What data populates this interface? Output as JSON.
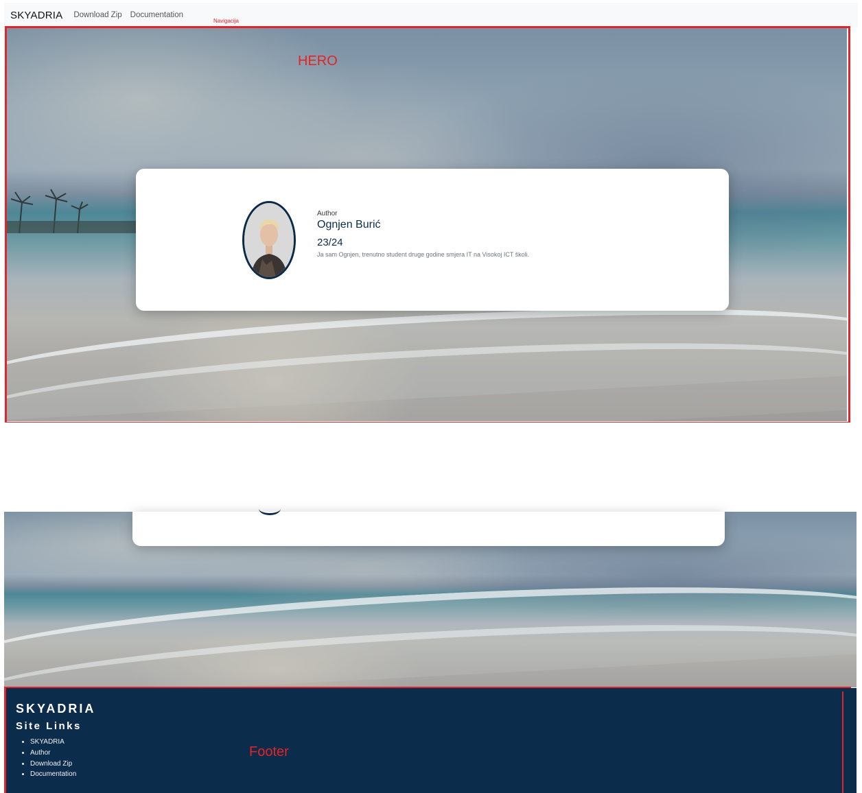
{
  "annotations": {
    "nav": "Navigacija",
    "hero": "HERO",
    "footer": "Footer"
  },
  "nav": {
    "brand": "SKYADRIA",
    "links": [
      "Download Zip",
      "Documentation"
    ]
  },
  "author_card": {
    "label": "Author",
    "name": "Ognjen Burić",
    "year": "23/24",
    "bio": "Ja sam Ognjen, trenutno student druge godine smjera IT na Visokoj ICT školi."
  },
  "footer": {
    "brand": "SKYADRIA",
    "heading": "Site Links",
    "links": [
      "SKYADRIA",
      "Author",
      "Download Zip",
      "Documentation"
    ]
  },
  "colors": {
    "navy": "#0b2c4b",
    "annotation_red": "#e0262c",
    "nav_bg": "#f8f9fa"
  },
  "icons": {
    "avatar": "author-photo"
  }
}
